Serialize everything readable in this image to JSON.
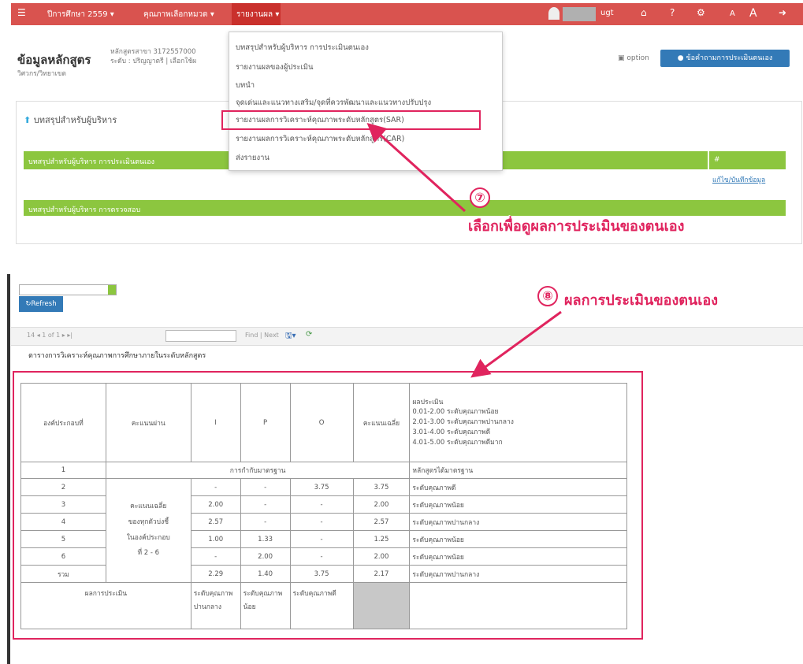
{
  "nav": {
    "year": "ปีการศึกษา 2559 ▾",
    "indicators": "คุณภาพเลือกหมวด ▾",
    "reports": "รายงานผล ▾",
    "username": "ugt",
    "icons": [
      "home-icon",
      "help-icon",
      "settings-icon",
      "font-small-icon",
      "font-large-icon",
      "logout-icon"
    ]
  },
  "dropdown": {
    "items": [
      "บทสรุปสำหรับผู้บริหาร การประเมินตนเอง",
      "รายงานผลของผู้ประเมิน",
      "บทนำ",
      "จุดเด่นและแนวทางเสริม/จุดที่ควรพัฒนาและแนวทางปรับปรุง",
      "รายงานผลการวิเคราะห์คุณภาพระดับหลักสูตร(SAR)",
      "รายงานผลการวิเคราะห์คุณภาพระดับหลักสูตร(CAR)",
      "ส่งรายงาน"
    ]
  },
  "header": {
    "title": "ข้อมูลหลักสูตร",
    "course_line1": "หลักสูตรสาขา 3172557000",
    "course_line2": "ระดับ : ปริญญาตรี | เลือกใช้ผ",
    "faculty": "วิศวกร/วิทยาเขต",
    "option_label": "option",
    "action_button": "ข้อคำถามการประเมินตนเอง"
  },
  "summary": {
    "heading": "บทสรุปสำหรับผู้บริหาร",
    "bar1": "บทสรุปสำหรับผู้บริหาร การประเมินตนเอง",
    "bar1_right": "#",
    "link": "แก้ไข/บันทึกข้อมูล",
    "bar2": "บทสรุปสำหรับผู้บริหาร การตรวจสอบ"
  },
  "annotations": {
    "num7": "⑦",
    "text7": "เลือกเพื่อดูผลการประเมินของตนเอง",
    "num8": "⑧",
    "text8": "ผลการประเมินของตนเอง"
  },
  "report": {
    "refresh_button": "Refresh",
    "pager": "14 ◂ 1  of 1 ▸ ▸|",
    "find_next": "Find | Next",
    "table_caption": "ตารางการวิเคราะห์คุณภาพการศึกษาภายในระดับหลักสูตร",
    "headers": {
      "composition": "องค์ประกอบที่",
      "passing": "คะแนนผ่าน",
      "i": "I",
      "p": "P",
      "o": "O",
      "average": "คะแนนเฉลี่ย",
      "criteria": [
        "ผลประเมิน",
        "0.01-2.00 ระดับคุณภาพน้อย",
        "2.01-3.00 ระดับคุณภาพปานกลาง",
        "3.01-4.00 ระดับคุณภาพดี",
        "4.01-5.00 ระดับคุณภาพดีมาก"
      ]
    },
    "row1": {
      "no": "1",
      "middle": "การกำกับมาตรฐาน",
      "result": "หลักสูตรได้มาตรฐาน"
    },
    "merged_label": [
      "คะแนนเฉลี่ย",
      "ของทุกตัวบ่งชี้",
      "ในองค์ประกอบ",
      "ที่ 2 - 6"
    ],
    "rows": [
      {
        "no": "2",
        "i": "-",
        "p": "-",
        "o": "3.75",
        "avg": "3.75",
        "result": "ระดับคุณภาพดี"
      },
      {
        "no": "3",
        "i": "2.00",
        "p": "-",
        "o": "-",
        "avg": "2.00",
        "result": "ระดับคุณภาพน้อย"
      },
      {
        "no": "4",
        "i": "2.57",
        "p": "-",
        "o": "-",
        "avg": "2.57",
        "result": "ระดับคุณภาพปานกลาง"
      },
      {
        "no": "5",
        "i": "1.00",
        "p": "1.33",
        "o": "-",
        "avg": "1.25",
        "result": "ระดับคุณภาพน้อย"
      },
      {
        "no": "6",
        "i": "-",
        "p": "2.00",
        "o": "-",
        "avg": "2.00",
        "result": "ระดับคุณภาพน้อย"
      },
      {
        "no": "รวม",
        "i": "2.29",
        "p": "1.40",
        "o": "3.75",
        "avg": "2.17",
        "result": "ระดับคุณภาพปานกลาง"
      }
    ],
    "footer": {
      "label": "ผลการประเมิน",
      "i": "ระดับคุณภาพปานกลาง",
      "p": "ระดับคุณภาพน้อย",
      "o": "ระดับคุณภาพดี"
    }
  },
  "colors": {
    "nav": "#d9534f",
    "green": "#8cc63f",
    "accent": "#e0245e",
    "button": "#337ab7"
  }
}
